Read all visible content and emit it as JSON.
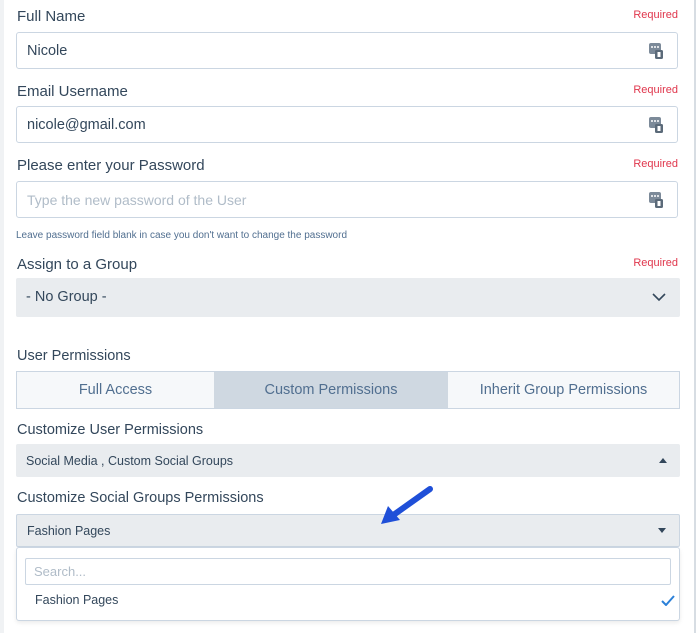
{
  "form": {
    "full_name": {
      "label": "Full Name",
      "required": "Required",
      "value": "Nicole"
    },
    "email": {
      "label": "Email Username",
      "required": "Required",
      "value": "nicole@gmail.com"
    },
    "password": {
      "label": "Please enter your Password",
      "required": "Required",
      "placeholder": "Type the new password of the User",
      "hint": "Leave password field blank in case you don't want to change the password"
    },
    "group": {
      "label": "Assign to a Group",
      "required": "Required",
      "value": "- No Group -"
    }
  },
  "permissions": {
    "label": "User Permissions",
    "tabs": [
      {
        "label": "Full Access"
      },
      {
        "label": "Custom Permissions",
        "active": true
      },
      {
        "label": "Inherit Group Permissions"
      }
    ],
    "customize_user": {
      "label": "Customize User Permissions",
      "value": "Social Media , Custom Social Groups"
    },
    "customize_social": {
      "label": "Customize Social Groups Permissions",
      "value": "Fashion Pages"
    },
    "dropdown": {
      "search_placeholder": "Search...",
      "options": [
        {
          "label": "Fashion Pages",
          "selected": true
        }
      ]
    }
  },
  "icons": {
    "field_icon": "key-card-icon",
    "chevron": "chevron-down-icon",
    "caret_up": "caret-up-icon",
    "caret_down": "caret-down-icon",
    "check": "check-icon",
    "arrow": "blue-arrow-annotation"
  },
  "colors": {
    "required": "#e0364c",
    "tab_active": "#cfd8e1",
    "select_bg": "#e9ecef",
    "check": "#2b80d8",
    "arrow": "#1f4fd8"
  }
}
